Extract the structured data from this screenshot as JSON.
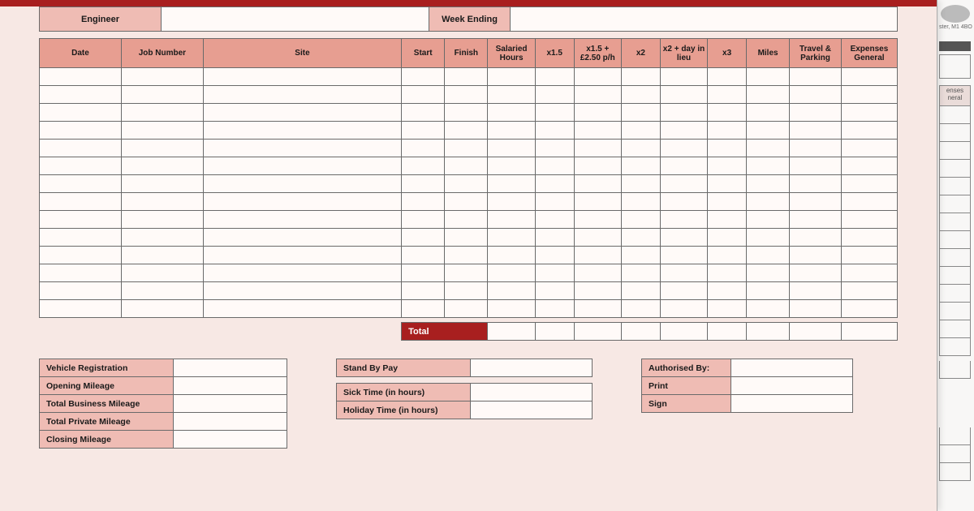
{
  "peek": {
    "address_tail": "ster, M1 4BO",
    "col_hdr_a": "enses",
    "col_hdr_b": "neral"
  },
  "header": {
    "engineer_label": "Engineer",
    "engineer_value": "",
    "week_ending_label": "Week Ending",
    "week_ending_value": ""
  },
  "columns": [
    "Date",
    "Job Number",
    "Site",
    "Start",
    "Finish",
    "Salaried Hours",
    "x1.5",
    "x1.5 + £2.50 p/h",
    "x2",
    "x2 + day in lieu",
    "x3",
    "Miles",
    "Travel & Parking",
    "Expenses General"
  ],
  "row_count": 14,
  "total_label": "Total",
  "mileage": {
    "vehicle_reg": "Vehicle Registration",
    "opening": "Opening Mileage",
    "business": "Total Business Mileage",
    "private": "Total Private Mileage",
    "closing": "Closing Mileage"
  },
  "pay": {
    "standby": "Stand By Pay",
    "sick": "Sick Time (in hours)",
    "holiday": "Holiday Time (in hours)"
  },
  "auth": {
    "by": "Authorised By:",
    "print": "Print",
    "sign": "Sign"
  }
}
